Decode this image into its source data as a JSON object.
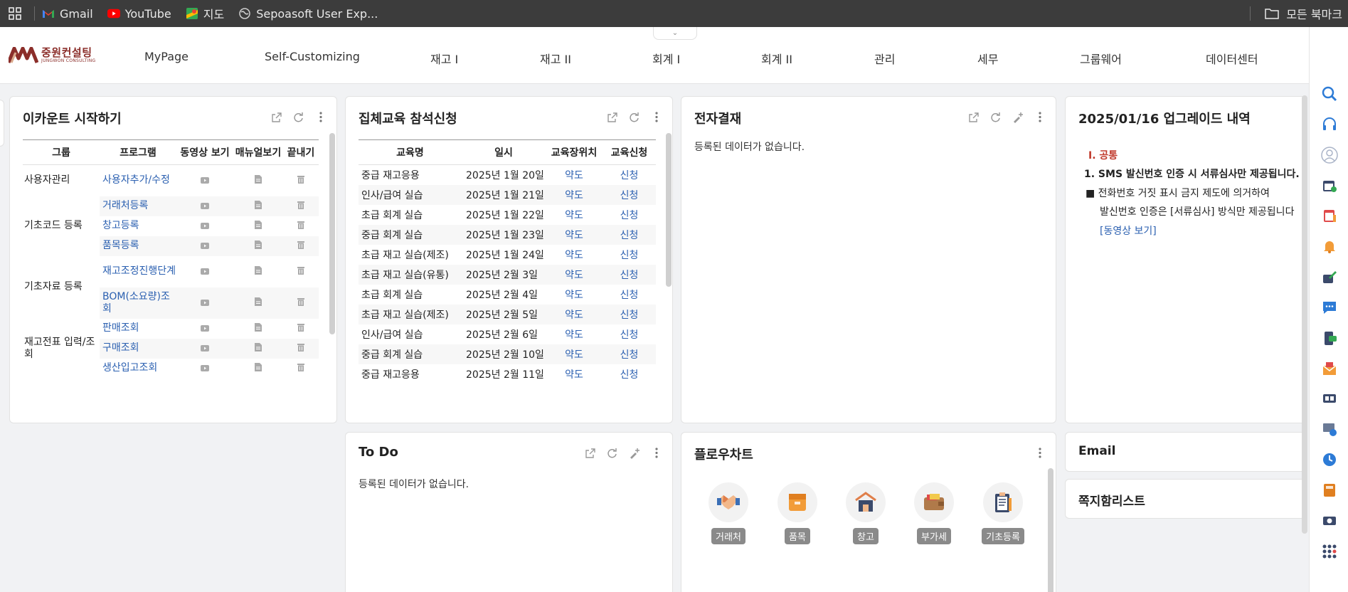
{
  "bookmarks": {
    "items": [
      {
        "label": "Gmail"
      },
      {
        "label": "YouTube"
      },
      {
        "label": "지도"
      },
      {
        "label": "Sepoasoft User Exp..."
      }
    ],
    "all_bookmarks": "모든 북마크"
  },
  "header": {
    "logo_ko": "중원컨설팅",
    "logo_en": "JUNGWON CONSULTING",
    "nav": [
      "MyPage",
      "Self-Customizing",
      "재고 I",
      "재고 II",
      "회계 I",
      "회계 II",
      "관리",
      "세무",
      "그룹웨어",
      "데이터센터"
    ]
  },
  "account_start": {
    "title": "이카운트 시작하기",
    "columns": [
      "그룹",
      "프로그램",
      "동영상 보기",
      "매뉴얼보기",
      "끝내기"
    ],
    "groups": [
      {
        "name": "사용자관리",
        "programs": [
          "사용자추가/수정"
        ]
      },
      {
        "name": "기초코드 등록",
        "programs": [
          "거래처등록",
          "창고등록",
          "품목등록"
        ]
      },
      {
        "name": "기초자료 등록",
        "programs": [
          "재고조정진행단계",
          "BOM(소요량)조회"
        ]
      },
      {
        "name": "재고전표 입력/조회",
        "programs": [
          "판매조회",
          "구매조회",
          "생산입고조회"
        ]
      }
    ]
  },
  "education": {
    "title": "집체교육 참석신청",
    "columns": [
      "교육명",
      "일시",
      "교육장위치",
      "교육신청"
    ],
    "rows": [
      {
        "name": "중급 재고응용",
        "date": "2025년 1월 20일",
        "loc": "약도",
        "apply": "신청"
      },
      {
        "name": "인사/급여 실습",
        "date": "2025년 1월 21일",
        "loc": "약도",
        "apply": "신청"
      },
      {
        "name": "초급 회계 실습",
        "date": "2025년 1월 22일",
        "loc": "약도",
        "apply": "신청"
      },
      {
        "name": "중급 회계 실습",
        "date": "2025년 1월 23일",
        "loc": "약도",
        "apply": "신청"
      },
      {
        "name": "초급 재고 실습(제조)",
        "date": "2025년 1월 24일",
        "loc": "약도",
        "apply": "신청"
      },
      {
        "name": "초급 재고 실습(유통)",
        "date": "2025년 2월 3일",
        "loc": "약도",
        "apply": "신청"
      },
      {
        "name": "초급 회계 실습",
        "date": "2025년 2월 4일",
        "loc": "약도",
        "apply": "신청"
      },
      {
        "name": "초급 재고 실습(제조)",
        "date": "2025년 2월 5일",
        "loc": "약도",
        "apply": "신청"
      },
      {
        "name": "인사/급여 실습",
        "date": "2025년 2월 6일",
        "loc": "약도",
        "apply": "신청"
      },
      {
        "name": "중급 회계 실습",
        "date": "2025년 2월 10일",
        "loc": "약도",
        "apply": "신청"
      },
      {
        "name": "중급 재고응용",
        "date": "2025년 2월 11일",
        "loc": "약도",
        "apply": "신청"
      }
    ]
  },
  "approval": {
    "title": "전자결재",
    "empty": "등록된 데이터가 없습니다."
  },
  "upgrade": {
    "title": "2025/01/16 업그레이드 내역",
    "section": "Ⅰ. 공통",
    "item1": "1. SMS 발신번호 인증 시 서류심사만 제공됩니다.",
    "bullet": "■ 전화번호 거짓 표시 금지 제도에 의거하여",
    "bullet_cont": "발신번호 인증은 [서류심사] 방식만 제공됩니다",
    "video_link": "[동영상 보기]"
  },
  "todo": {
    "title": "To Do",
    "empty": "등록된 데이터가 없습니다."
  },
  "flowchart": {
    "title": "플로우차트",
    "items": [
      {
        "label": "거래처"
      },
      {
        "label": "품목"
      },
      {
        "label": "창고"
      },
      {
        "label": "부가세"
      },
      {
        "label": "기초등록"
      }
    ]
  },
  "email": {
    "title": "Email"
  },
  "notes": {
    "title": "쪽지함리스트"
  },
  "colors": {
    "accent_red": "#c0392b",
    "link_blue": "#2a5fb0",
    "logo": "#8b2e2a"
  }
}
